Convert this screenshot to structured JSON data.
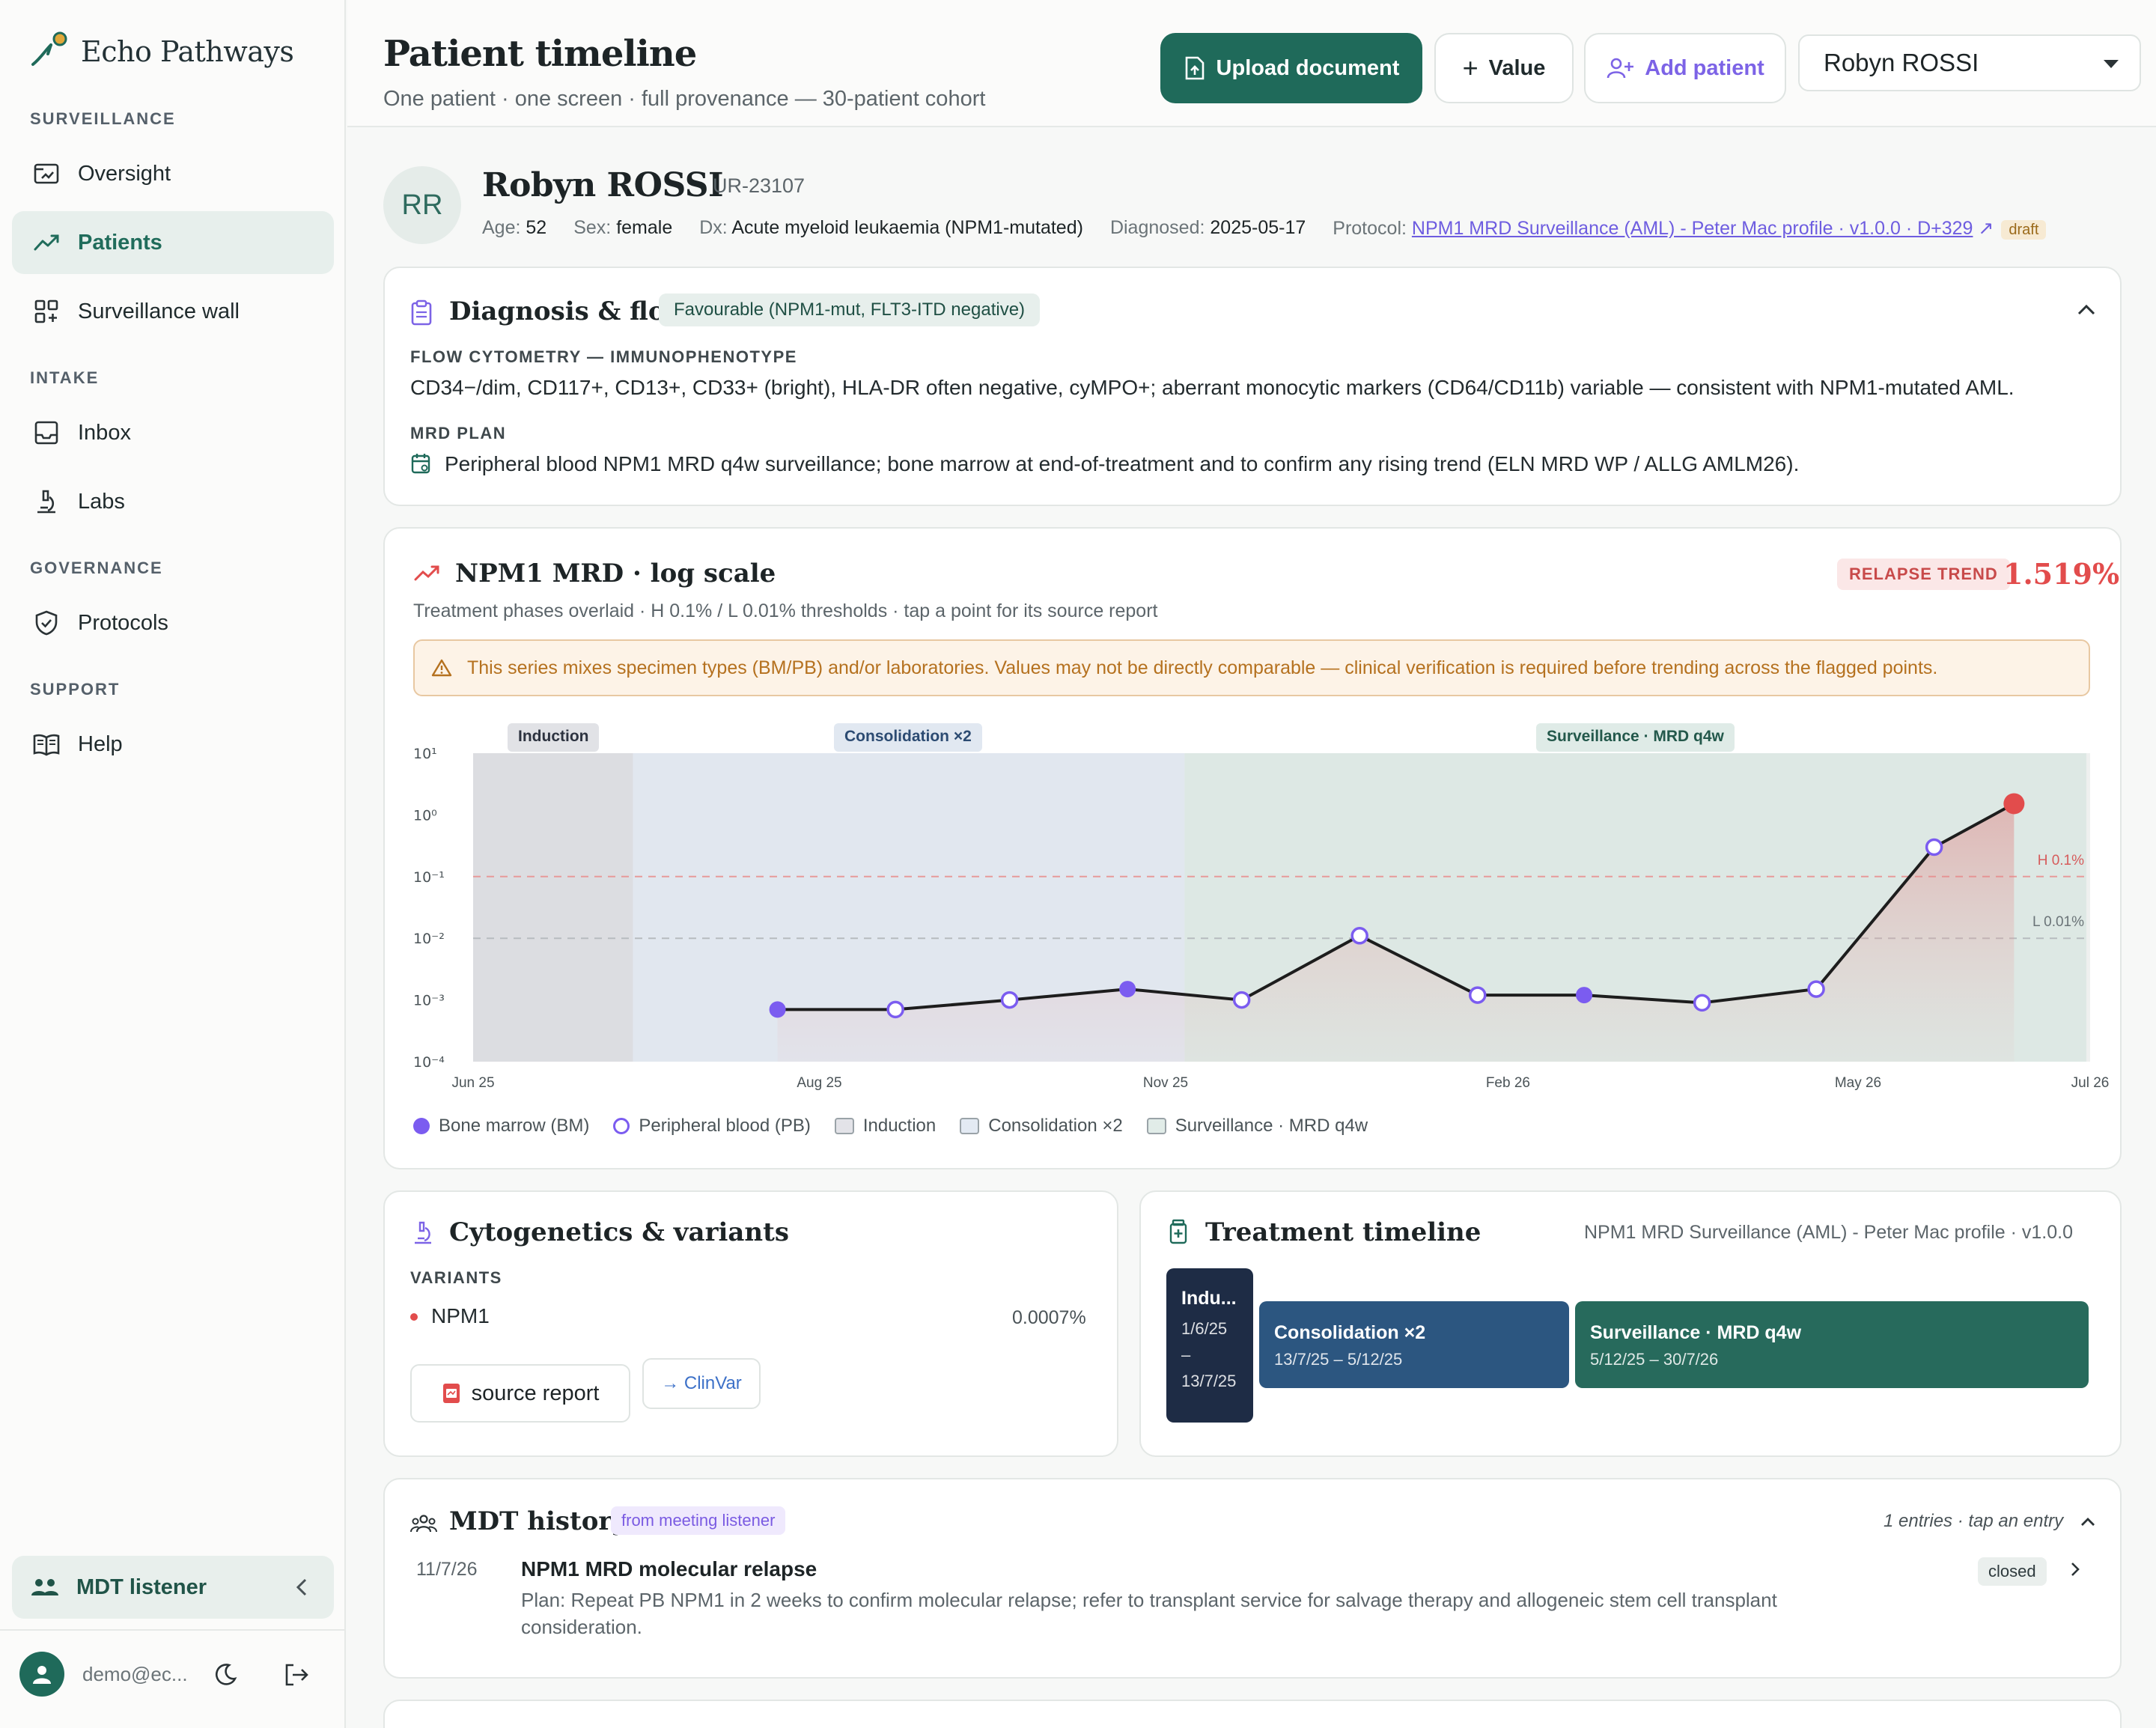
{
  "app": {
    "brand": "Echo Pathways"
  },
  "sidebar": {
    "sections": {
      "surveillance": "SURVEILLANCE",
      "intake": "INTAKE",
      "governance": "GOVERNANCE",
      "support": "SUPPORT"
    },
    "items": [
      {
        "label": "Oversight",
        "icon": "oversight-icon"
      },
      {
        "label": "Patients",
        "icon": "trend-line-icon",
        "active": true
      },
      {
        "label": "Surveillance wall",
        "icon": "grid-plus-icon"
      },
      {
        "label": "Inbox",
        "icon": "inbox-icon"
      },
      {
        "label": "Labs",
        "icon": "microscope-icon"
      },
      {
        "label": "Protocols",
        "icon": "shield-check-icon"
      },
      {
        "label": "Help",
        "icon": "book-icon"
      }
    ],
    "mdt_listener": "MDT listener",
    "user_email": "demo@ec..."
  },
  "header": {
    "title": "Patient timeline",
    "subtitle": "One patient · one screen · full provenance — 30-patient cohort",
    "upload_label": "Upload document",
    "value_label": "Value",
    "add_patient_label": "Add patient",
    "patient_select_value": "Robyn ROSSI"
  },
  "patient": {
    "initials": "RR",
    "name": "Robyn ROSSI",
    "id": "UR-23107",
    "age_label": "Age:",
    "age": "52",
    "sex_label": "Sex:",
    "sex": "female",
    "dx_label": "Dx:",
    "dx": "Acute myeloid leukaemia (NPM1-mutated)",
    "diagnosed_label": "Diagnosed:",
    "diagnosed": "2025-05-17",
    "protocol_label": "Protocol:",
    "protocol": "NPM1 MRD Surveillance (AML) - Peter Mac profile · v1.0.0 · D+329",
    "protocol_status": "draft"
  },
  "diagnosis": {
    "title": "Diagnosis & flow",
    "risk": "Favourable (NPM1-mut, FLT3-ITD negative)",
    "flow_label": "FLOW CYTOMETRY — IMMUNOPHENOTYPE",
    "flow_text": "CD34−/dim, CD117+, CD13+, CD33+ (bright), HLA-DR often negative, cyMPO+; aberrant monocytic markers (CD64/CD11b) variable — consistent with NPM1-mutated AML.",
    "mrd_label": "MRD PLAN",
    "mrd_text": "Peripheral blood NPM1 MRD q4w surveillance; bone marrow at end-of-treatment and to confirm any rising trend (ELN MRD WP / ALLG AMLM26)."
  },
  "mrd_chart": {
    "title": "NPM1 MRD · log scale",
    "subtitle": "Treatment phases overlaid · H 0.1% / L 0.01% thresholds · tap a point for its source report",
    "trend_badge": "RELAPSE TREND",
    "latest_value": "1.519%",
    "warning": "This series mixes specimen types (BM/PB) and/or laboratories. Values may not be directly comparable — clinical verification is required before trending across the flagged points.",
    "phases": [
      "Induction",
      "Consolidation ×2",
      "Surveillance · MRD q4w"
    ],
    "legend": {
      "bm": "Bone marrow (BM)",
      "pb": "Peripheral blood (PB)",
      "induction": "Induction",
      "consolidation": "Consolidation ×2",
      "surveillance": "Surveillance · MRD q4w"
    },
    "threshold_h": "H 0.1%",
    "threshold_l": "L 0.01%",
    "colors": {
      "bm": "#7b5cf0",
      "pb_stroke": "#7b5cf0",
      "latest": "#e24c4c",
      "line": "#1d1d1d",
      "h_line": "#e79a9a",
      "l_line": "#b7bcbf"
    }
  },
  "chart_data": {
    "type": "line",
    "title": "NPM1 MRD · log scale",
    "yscale": "log",
    "ylim": [
      0.0001,
      10
    ],
    "y_ticks": [
      "10¹",
      "10⁰",
      "10⁻¹",
      "10⁻²",
      "10⁻³",
      "10⁻⁴"
    ],
    "x_ticks": [
      "Jun 25",
      "Aug 25",
      "Nov 25",
      "Feb 26",
      "May 26",
      "Jul 26"
    ],
    "thresholds": [
      {
        "name": "H 0.1%",
        "value": 0.1
      },
      {
        "name": "L 0.01%",
        "value": 0.01
      }
    ],
    "phases": [
      {
        "name": "Induction",
        "start": "2025-06-01",
        "end": "2025-07-13"
      },
      {
        "name": "Consolidation ×2",
        "start": "2025-07-13",
        "end": "2025-12-05"
      },
      {
        "name": "Surveillance · MRD q4w",
        "start": "2025-12-05",
        "end": "2026-07-30"
      }
    ],
    "series": [
      {
        "name": "NPM1 MRD",
        "points": [
          {
            "x": "2025-08-20",
            "y": 0.0007,
            "specimen": "BM"
          },
          {
            "x": "2025-09-20",
            "y": 0.0007,
            "specimen": "PB"
          },
          {
            "x": "2025-10-20",
            "y": 0.001,
            "specimen": "PB"
          },
          {
            "x": "2025-11-20",
            "y": 0.0015,
            "specimen": "BM"
          },
          {
            "x": "2025-12-20",
            "y": 0.001,
            "specimen": "PB"
          },
          {
            "x": "2026-01-20",
            "y": 0.011,
            "specimen": "PB"
          },
          {
            "x": "2026-02-20",
            "y": 0.0012,
            "specimen": "PB"
          },
          {
            "x": "2026-03-20",
            "y": 0.0012,
            "specimen": "BM"
          },
          {
            "x": "2026-04-20",
            "y": 0.0009,
            "specimen": "PB"
          },
          {
            "x": "2026-05-20",
            "y": 0.0015,
            "specimen": "PB"
          },
          {
            "x": "2026-06-20",
            "y": 0.3,
            "specimen": "PB"
          },
          {
            "x": "2026-07-11",
            "y": 1.519,
            "specimen": "latest"
          }
        ]
      }
    ]
  },
  "cytogenetics": {
    "title": "Cytogenetics & variants",
    "variants_label": "VARIANTS",
    "variant_name": "NPM1",
    "variant_value": "0.0007%",
    "source_label": "source report",
    "clinvar_label": "→ ClinVar"
  },
  "treatment": {
    "title": "Treatment timeline",
    "protocol": "NPM1 MRD Surveillance (AML) - Peter Mac profile · v1.0.0",
    "blocks": [
      {
        "name": "Indu...",
        "dates": "1/6/25 – 13/7/25",
        "color": "#1e2c45"
      },
      {
        "name": "Consolidation ×2",
        "dates": "13/7/25 – 5/12/25",
        "color": "#2c5680"
      },
      {
        "name": "Surveillance · MRD q4w",
        "dates": "5/12/25 – 30/7/26",
        "color": "#276a5c"
      }
    ]
  },
  "mdt": {
    "title": "MDT history",
    "source": "from meeting listener",
    "count": "1 entries · tap an entry",
    "entry": {
      "date": "11/7/26",
      "title": "NPM1 MRD molecular relapse",
      "plan_line1": "Plan: Repeat PB NPM1 in 2 weeks to confirm molecular relapse; refer to transplant service for salvage therapy and allogeneic stem cell transplant",
      "plan_line2": "consideration.",
      "status": "closed"
    }
  }
}
